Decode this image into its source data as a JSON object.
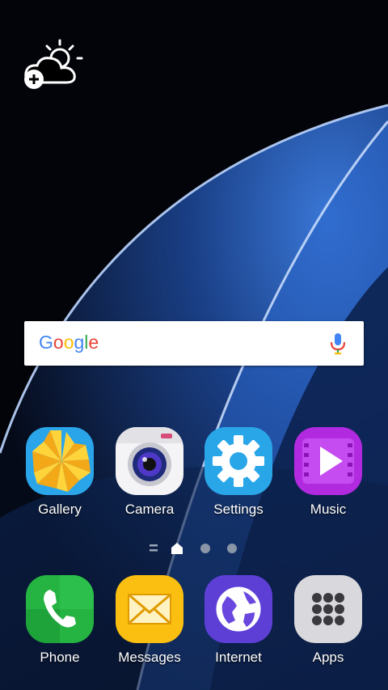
{
  "search": {
    "logo_text": [
      "G",
      "o",
      "o",
      "g",
      "l",
      "e"
    ]
  },
  "apps": [
    {
      "label": "Gallery",
      "icon": "gallery-icon"
    },
    {
      "label": "Camera",
      "icon": "camera-icon"
    },
    {
      "label": "Settings",
      "icon": "gear-icon"
    },
    {
      "label": "Music",
      "icon": "play-icon"
    }
  ],
  "dock": [
    {
      "label": "Phone",
      "icon": "phone-icon"
    },
    {
      "label": "Messages",
      "icon": "envelope-icon"
    },
    {
      "label": "Internet",
      "icon": "globe-icon"
    },
    {
      "label": "Apps",
      "icon": "app-grid-icon"
    }
  ],
  "page_indicator": {
    "pages": 2,
    "current": "home"
  },
  "colors": {
    "google_blue": "#4285F4",
    "google_red": "#EA4335",
    "google_yellow": "#FBBC05",
    "google_green": "#34A853"
  }
}
